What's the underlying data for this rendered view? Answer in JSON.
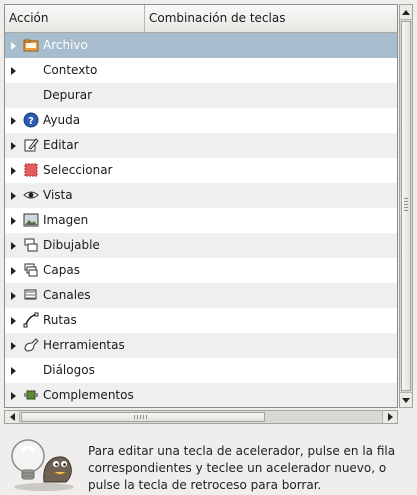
{
  "columns": {
    "action": "Acción",
    "shortcut": "Combinación de teclas"
  },
  "rows": [
    {
      "label": "Archivo",
      "icon": "folder-icon",
      "expander": true,
      "selected": true
    },
    {
      "label": "Contexto",
      "icon": "",
      "expander": true
    },
    {
      "label": "Depurar",
      "icon": "",
      "expander": false
    },
    {
      "label": "Ayuda",
      "icon": "help-icon",
      "expander": true
    },
    {
      "label": "Editar",
      "icon": "edit-icon",
      "expander": true
    },
    {
      "label": "Seleccionar",
      "icon": "selection-icon",
      "expander": true
    },
    {
      "label": "Vista",
      "icon": "eye-icon",
      "expander": true
    },
    {
      "label": "Imagen",
      "icon": "image-icon",
      "expander": true
    },
    {
      "label": "Dibujable",
      "icon": "drawable-icon",
      "expander": true
    },
    {
      "label": "Capas",
      "icon": "layers-icon",
      "expander": true
    },
    {
      "label": "Canales",
      "icon": "channels-icon",
      "expander": true
    },
    {
      "label": "Rutas",
      "icon": "paths-icon",
      "expander": true
    },
    {
      "label": "Herramientas",
      "icon": "tools-icon",
      "expander": true
    },
    {
      "label": "Diálogos",
      "icon": "",
      "expander": true
    },
    {
      "label": "Complementos",
      "icon": "plugin-icon",
      "expander": true
    }
  ],
  "hint": "Para editar una tecla de acelerador, pulse en la fila correspondientes y teclee un acelerador nuevo, o pulse la tecla de retroceso para borrar.",
  "colors": {
    "selection": "#a7bdcd",
    "row_alt": "#efefef"
  }
}
